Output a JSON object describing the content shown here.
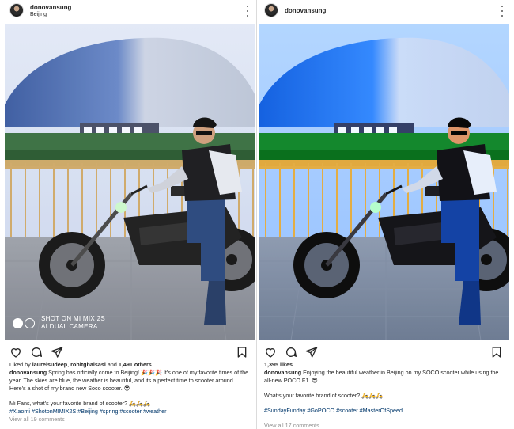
{
  "left_post": {
    "username": "donovansung",
    "location": "Beijing",
    "watermark": {
      "line1": "SHOT ON MI MIX 2S",
      "line2": "AI DUAL CAMERA"
    },
    "likes_prefix": "Liked by",
    "likes_user1": "laurelsudeep",
    "likes_sep": ",",
    "likes_user2": "rohitghalsasi",
    "likes_and": "and",
    "likes_count": "1,491 others",
    "caption_user": "donovansung",
    "caption_text": "Spring has officially come to Beijing! 🎉🎉🎉 It's one of my favorite times of the year. The skies are blue, the weather is beautiful, and its a perfect time to scooter around. Here's a shot of my brand new Soco scooter. 😎",
    "question": "Mi Fans, what's your favorite brand of scooter? 🛵🛵🛵",
    "hashtags": "#Xiaomi #ShotonMIMIX2S #Beijing #spring #scooter #weather",
    "view_comments": "View all 19 comments"
  },
  "right_post": {
    "username": "donovansung",
    "likes": "1,395 likes",
    "caption_user": "donovansung",
    "caption_text": "Enjoying the beautiful weather in Beijing on my SOCO scooter while using the all-new POCO F1. 😎",
    "question": "What's your favorite brand of scooter? 🛵🛵🛵",
    "hashtags": "#SundayFunday #GoPOCO #scooter #MasterOfSpeed",
    "view_comments": "View all 17 comments"
  },
  "icons": [
    "more-icon",
    "heart-icon",
    "comment-icon",
    "share-icon",
    "save-icon"
  ],
  "colors": {
    "hashtag": "#00376b",
    "sky_left": "#c9d3e6",
    "sky_right": "#a8c4ec",
    "muted_text": "#8e8e8e"
  }
}
